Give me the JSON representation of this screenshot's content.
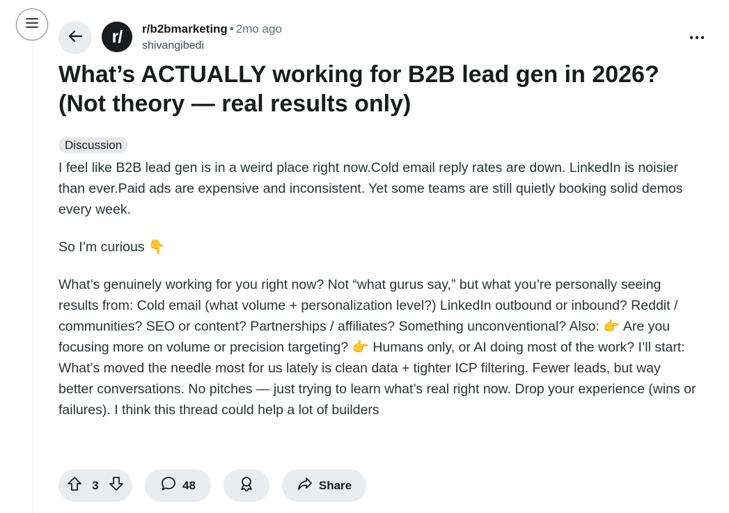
{
  "nav": {
    "menu_icon": "hamburger-icon",
    "back_icon": "arrow-left-icon"
  },
  "post": {
    "subreddit": "r/b2bmarketing",
    "subreddit_avatar": "r/",
    "separator": "•",
    "time_ago": "2mo ago",
    "author": "shivangibedi",
    "more_icon": "ellipsis-icon",
    "title": "What’s ACTUALLY working for B2B lead gen in 2026? (Not theory — real results only)",
    "flair": "Discussion",
    "body": {
      "paragraph_1": "I feel like B2B lead gen is in a weird place right now.Cold email reply rates are down. LinkedIn is noisier than ever.Paid ads are expensive and inconsistent. Yet some teams are still quietly booking solid demos every week.",
      "paragraph_2_text": "So I’m curious ",
      "paragraph_2_emoji": "👇",
      "paragraph_3_a": "What’s genuinely working for you right now? Not “what gurus say,” but what you’re personally seeing results from: Cold email (what volume + personalization level?) LinkedIn outbound or inbound? Reddit / communities? SEO or content? Partnerships / affiliates? Something unconventional? Also: ",
      "emoji_point": "👉",
      "paragraph_3_b": " Are you focusing more on volume or precision targeting? ",
      "paragraph_3_c": " Humans only, or AI doing most of the work? I’ll start: What’s moved the needle most for us lately is clean data + tighter ICP filtering. Fewer leads, but way better conversations. No pitches — just trying to learn what’s real right now. Drop your experience (wins or failures). I think this thread could help a lot of builders"
    }
  },
  "actions": {
    "upvote_icon": "arrow-up-icon",
    "vote_count": "3",
    "downvote_icon": "arrow-down-icon",
    "comment_icon": "speech-bubble-icon",
    "comment_count": "48",
    "award_icon": "award-icon",
    "share_icon": "share-arrow-icon",
    "share_label": "Share"
  },
  "colors": {
    "pill_bg": "#eaedef",
    "text_primary": "#181c1f",
    "text_muted": "#576f76"
  }
}
